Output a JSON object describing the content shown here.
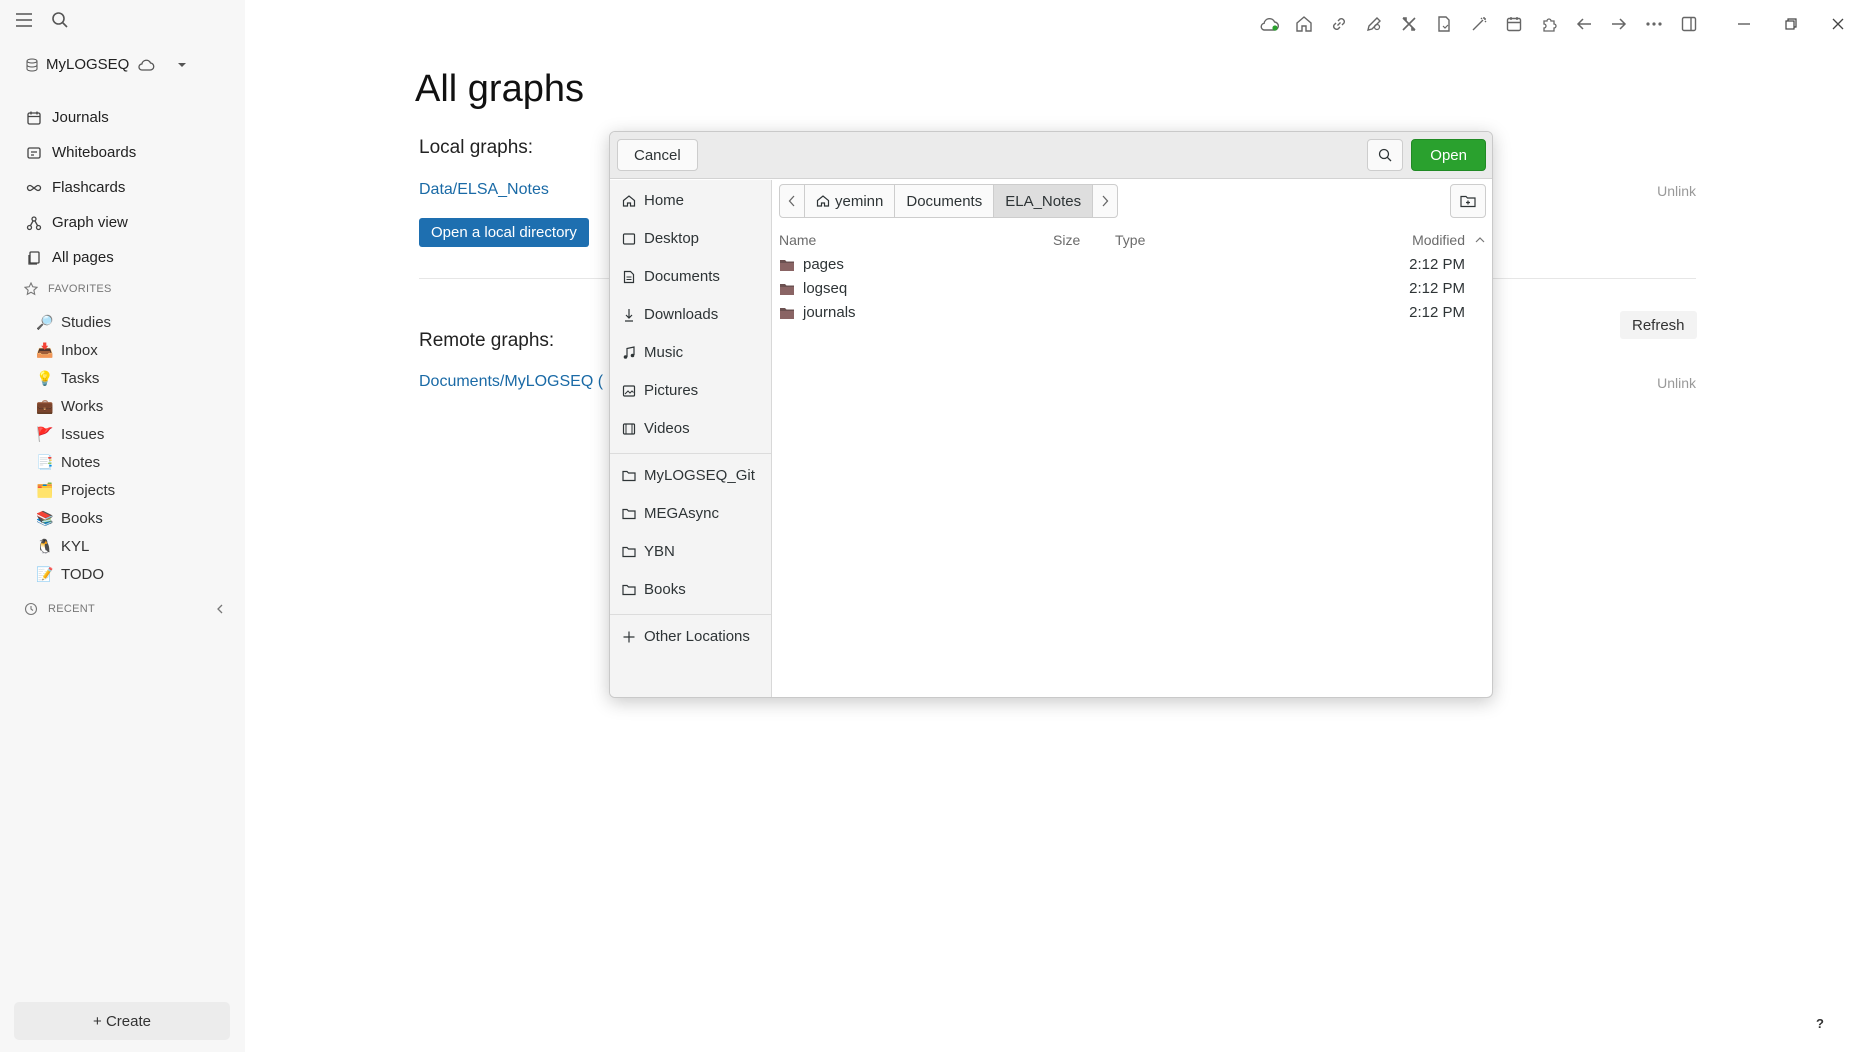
{
  "sidebar": {
    "graph_name": "MyLOGSEQ",
    "nav": [
      {
        "label": "Journals",
        "icon": "calendar-icon"
      },
      {
        "label": "Whiteboards",
        "icon": "whiteboard-icon"
      },
      {
        "label": "Flashcards",
        "icon": "infinity-icon"
      },
      {
        "label": "Graph view",
        "icon": "graph-icon"
      },
      {
        "label": "All pages",
        "icon": "pages-icon"
      }
    ],
    "favorites_label": "FAVORITES",
    "favorites": [
      {
        "emoji": "🔎",
        "label": "Studies"
      },
      {
        "emoji": "📥",
        "label": "Inbox"
      },
      {
        "emoji": "💡",
        "label": "Tasks"
      },
      {
        "emoji": "💼",
        "label": "Works"
      },
      {
        "emoji": "🚩",
        "label": "Issues"
      },
      {
        "emoji": "📑",
        "label": "Notes"
      },
      {
        "emoji": "🗂️",
        "label": "Projects"
      },
      {
        "emoji": "📚",
        "label": "Books"
      },
      {
        "emoji": "🐧",
        "label": "KYL"
      },
      {
        "emoji": "📝",
        "label": "TODO"
      }
    ],
    "recent_label": "RECENT",
    "create_label": "+ Create"
  },
  "main": {
    "title": "All graphs",
    "local_heading": "Local graphs:",
    "local_graph": "Data/ELSA_Notes",
    "open_dir_label": "Open a local directory",
    "remote_heading": "Remote graphs:",
    "remote_graph": "Documents/MyLOGSEQ (",
    "unlink_label": "Unlink",
    "refresh_label": "Refresh",
    "help_label": "?"
  },
  "dialog": {
    "cancel_label": "Cancel",
    "open_label": "Open",
    "places": [
      "Home",
      "Desktop",
      "Documents",
      "Downloads",
      "Music",
      "Pictures",
      "Videos"
    ],
    "bookmarks": [
      "MyLOGSEQ_Git",
      "MEGAsync",
      "YBN",
      "Books"
    ],
    "other_locations": "Other Locations",
    "path": [
      "yeminn",
      "Documents",
      "ELA_Notes"
    ],
    "columns": {
      "name": "Name",
      "size": "Size",
      "type": "Type",
      "modified": "Modified"
    },
    "files": [
      {
        "name": "pages",
        "modified": "2:12 PM"
      },
      {
        "name": "logseq",
        "modified": "2:12 PM"
      },
      {
        "name": "journals",
        "modified": "2:12 PM"
      }
    ]
  },
  "colors": {
    "accent": "#1e6fb0",
    "open_button": "#2aa12e",
    "link": "#1a6aa6"
  }
}
